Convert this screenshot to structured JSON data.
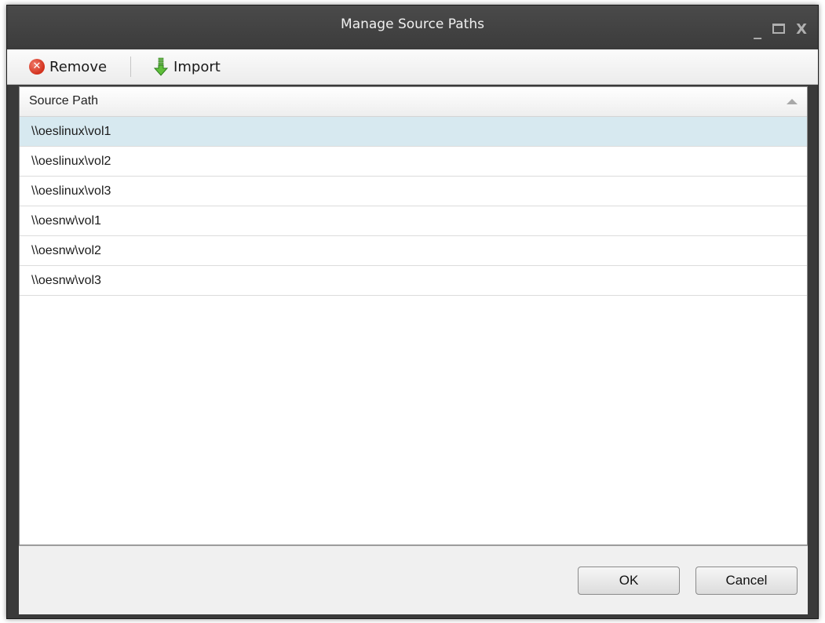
{
  "window": {
    "title": "Manage Source Paths",
    "controls": {
      "minimize": "_",
      "close": "X"
    }
  },
  "toolbar": {
    "remove_label": "Remove",
    "import_label": "Import",
    "remove_icon": "remove-circle-x",
    "import_icon": "import-arrow-down"
  },
  "list": {
    "column_header": "Source Path",
    "sort_direction": "ascending",
    "selected_index": 0,
    "rows": [
      "\\\\oeslinux\\vol1",
      "\\\\oeslinux\\vol2",
      "\\\\oeslinux\\vol3",
      "\\\\oesnw\\vol1",
      "\\\\oesnw\\vol2",
      "\\\\oesnw\\vol3"
    ]
  },
  "footer": {
    "ok_label": "OK",
    "cancel_label": "Cancel"
  },
  "colors": {
    "titlebar": "#3c3c3c",
    "selected_row": "#d7e9f0",
    "remove_icon": "#d2301c",
    "import_icon": "#3aa12a"
  }
}
